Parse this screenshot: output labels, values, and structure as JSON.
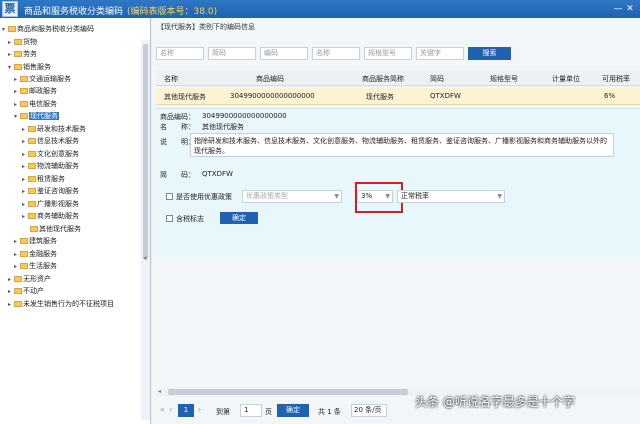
{
  "window": {
    "logo": "票",
    "title": "商品和服务税收分类编码",
    "version": "(编码表版本号：38.0)",
    "minimize": "—",
    "close": "✕"
  },
  "tree": {
    "root": "商品和服务税收分类编码",
    "items": [
      {
        "label": "货物"
      },
      {
        "label": "劳务"
      },
      {
        "label": "销售服务"
      },
      {
        "label": "交通运输服务"
      },
      {
        "label": "邮政服务"
      },
      {
        "label": "电信服务"
      },
      {
        "label": "现代服务"
      },
      {
        "label": "研发和技术服务"
      },
      {
        "label": "信息技术服务"
      },
      {
        "label": "文化创意服务"
      },
      {
        "label": "物流辅助服务"
      },
      {
        "label": "租赁服务"
      },
      {
        "label": "鉴证咨询服务"
      },
      {
        "label": "广播影视服务"
      },
      {
        "label": "商务辅助服务"
      },
      {
        "label": "其他现代服务"
      },
      {
        "label": "建筑服务"
      },
      {
        "label": "金融服务"
      },
      {
        "label": "生活服务"
      },
      {
        "label": "无形资产"
      },
      {
        "label": "不动产"
      },
      {
        "label": "未发生销售行为的不征税项目"
      }
    ],
    "splitter": "◂"
  },
  "main": {
    "breadcrumb": "【现代服务】类别下的编码信息",
    "filters": {
      "name": "名称",
      "code": "简码",
      "shortname": "编码",
      "category": "名称",
      "model": "规格型号",
      "keyword": "关键字",
      "search": "搜索"
    },
    "columns": [
      "名称",
      "商品编码",
      "商品服务简称",
      "简码",
      "规格型号",
      "计量单位",
      "可用税率"
    ],
    "row": {
      "name": "其他现代服务",
      "code": "3049900000000000000",
      "short": "现代服务",
      "abbr": "QTXDFW",
      "model": "",
      "unit": "",
      "rate": "6%"
    },
    "detail": {
      "code_label": "商品编码：",
      "code_value": "3049900000000000000",
      "name_label": "名　　称：",
      "name_value": "其他现代服务",
      "desc_label": "说　　明：",
      "desc": "指除研发和技术服务、信息技术服务、文化创意服务、物流辅助服务、租赁服务、鉴证咨询服务、广播影视服务和商务辅助服务以外的现代服务。",
      "abbr_label": "简　　码：",
      "abbr_value": "QTXDFW",
      "pref_label": "是否使用优惠政策",
      "pref_placeholder": "优惠政策类型",
      "rate_value": "3%",
      "rate_type": "正常税率",
      "tax_included_label": "含税标志",
      "ok": "确定"
    },
    "pager": {
      "first": "«",
      "prev": "‹",
      "page": "1",
      "goto_label": "到第",
      "page_input": "1",
      "page_unit": "页",
      "next": "›",
      "last": "»",
      "go": "确定",
      "total": "共 1 条",
      "page_size": "20 条/页"
    }
  },
  "watermark": "头条 @听说名字最多是十个字"
}
